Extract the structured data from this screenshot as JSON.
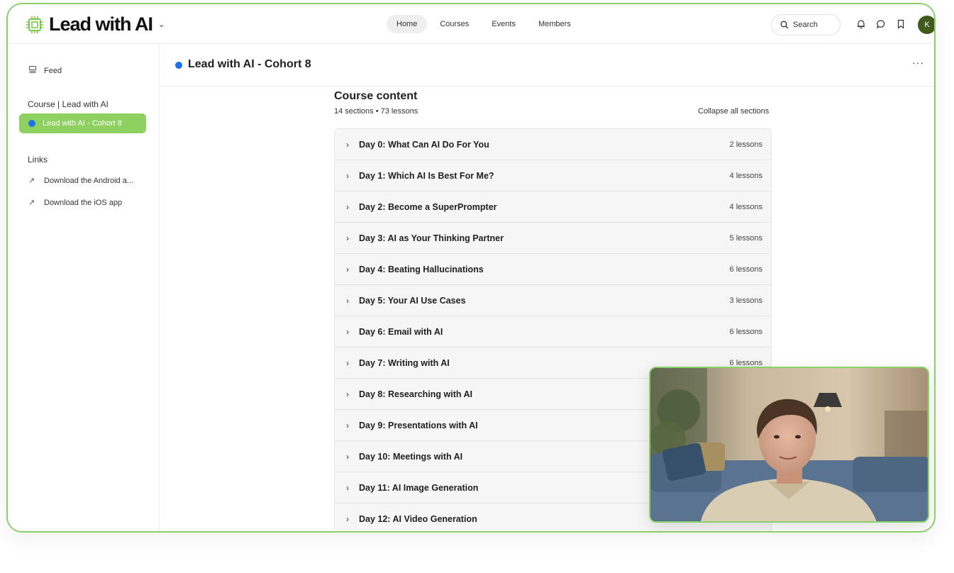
{
  "brand": {
    "name": "Lead with AI",
    "accent": "#8bd06a"
  },
  "nav": {
    "items": [
      "Home",
      "Courses",
      "Events",
      "Members"
    ],
    "active": "Home"
  },
  "search": {
    "label": "Search"
  },
  "user": {
    "initial": "K"
  },
  "sidebar": {
    "feed": "Feed",
    "course_heading": "Course | Lead with AI",
    "active_item": "Lead with AI - Cohort 8",
    "links_heading": "Links",
    "links": [
      "Download the Android a...",
      "Download the iOS app"
    ]
  },
  "header": {
    "title": "Lead with AI - Cohort 8"
  },
  "course": {
    "title": "Course content",
    "meta": "14 sections • 73 lessons",
    "collapse": "Collapse all sections",
    "sections": [
      {
        "title": "Day 0: What Can AI Do For You",
        "count": "2 lessons"
      },
      {
        "title": "Day 1: Which AI Is Best For Me?",
        "count": "4 lessons"
      },
      {
        "title": "Day 2: Become a SuperPrompter",
        "count": "4 lessons"
      },
      {
        "title": "Day 3: AI as Your Thinking Partner",
        "count": "5 lessons"
      },
      {
        "title": "Day 4: Beating Hallucinations",
        "count": "6 lessons"
      },
      {
        "title": "Day 5: Your AI Use Cases",
        "count": "3 lessons"
      },
      {
        "title": "Day 6: Email with AI",
        "count": "6 lessons"
      },
      {
        "title": "Day 7: Writing with AI",
        "count": "6 lessons"
      },
      {
        "title": "Day 8: Researching with AI",
        "count": ""
      },
      {
        "title": "Day 9: Presentations with AI",
        "count": ""
      },
      {
        "title": "Day 10: Meetings with AI",
        "count": ""
      },
      {
        "title": "Day 11: AI Image Generation",
        "count": ""
      },
      {
        "title": "Day 12: AI Video Generation",
        "count": ""
      }
    ]
  }
}
